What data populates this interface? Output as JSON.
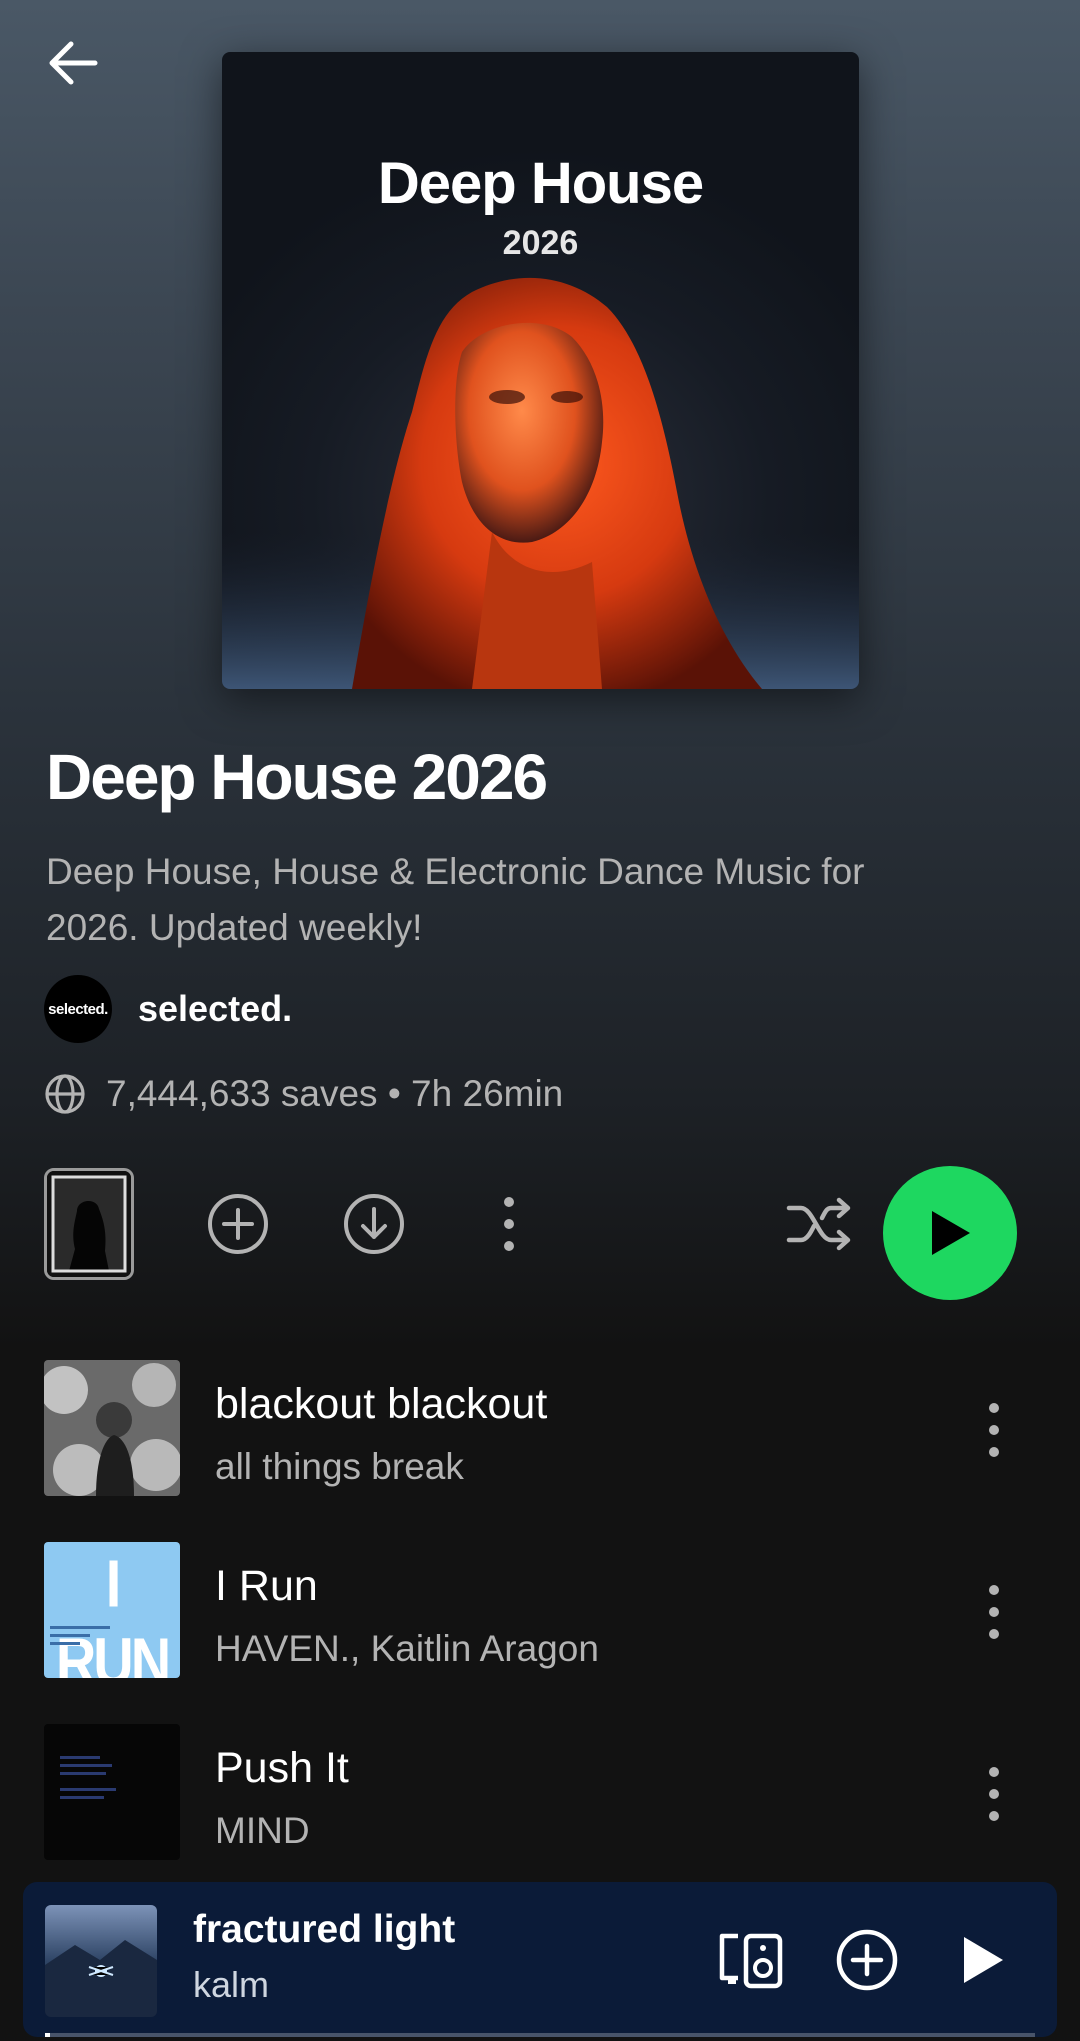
{
  "cover": {
    "title": "Deep House",
    "year": "2026"
  },
  "playlist": {
    "title": "Deep House 2026",
    "description": "Deep House, House & Electronic Dance Music for 2026. Updated weekly!",
    "owner": {
      "avatar_text": "selected.",
      "name": "selected."
    },
    "meta": "7,444,633 saves • 7h 26min"
  },
  "icons": {
    "back": "arrow-left-icon",
    "globe": "globe-icon",
    "add": "plus-circle-icon",
    "download": "download-circle-icon",
    "more": "more-vertical-icon",
    "shuffle": "shuffle-icon",
    "play": "play-icon",
    "device": "connect-device-icon"
  },
  "colors": {
    "accent": "#1ed760",
    "mini_player_bg": "#0b1b38",
    "secondary_text": "#b3b3b3"
  },
  "tracks": [
    {
      "title": "blackout blackout",
      "artist": "all things break"
    },
    {
      "title": "I Run",
      "artist": "HAVEN., Kaitlin Aragon",
      "art_text": "I RUN"
    },
    {
      "title": "Push It",
      "artist": "MIND"
    }
  ],
  "now_playing": {
    "title": "fractured light",
    "artist": "kalm",
    "progress": 0.005
  }
}
